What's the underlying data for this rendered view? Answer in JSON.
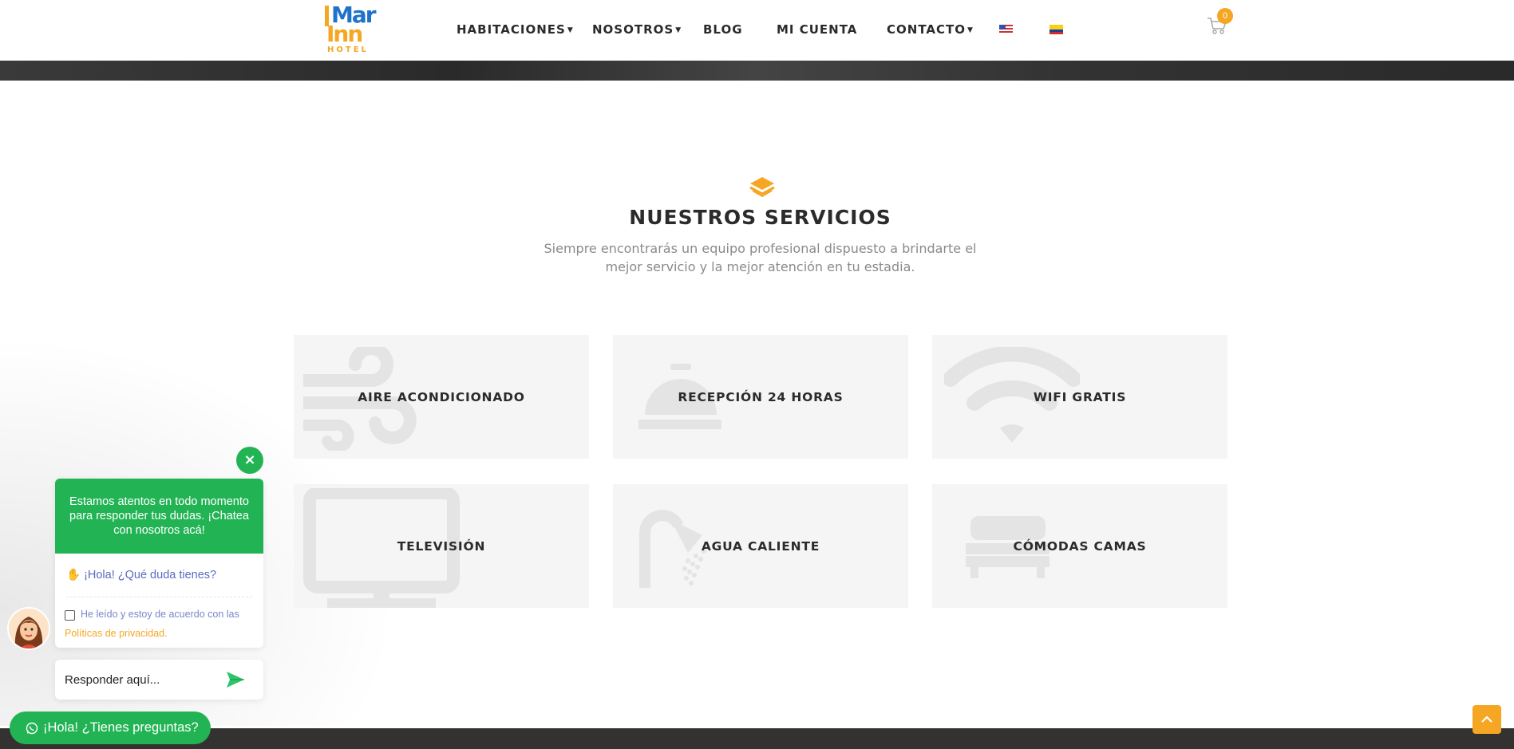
{
  "logo": {
    "line1": "Mar",
    "line2": "Inn",
    "line3": "HOTEL"
  },
  "nav": {
    "items": [
      {
        "label": "HABITACIONES",
        "has_dropdown": true
      },
      {
        "label": "NOSOTROS",
        "has_dropdown": true
      },
      {
        "label": "BLOG",
        "has_dropdown": false
      },
      {
        "label": "MI CUENTA",
        "has_dropdown": false
      },
      {
        "label": "CONTACTO",
        "has_dropdown": true
      }
    ],
    "languages": [
      "us-flag",
      "colombia-flag"
    ],
    "cart_count": "0"
  },
  "services": {
    "title": "NUESTROS SERVICIOS",
    "subtitle": "Siempre encontrarás un equipo profesional dispuesto a brindarte el mejor servicio y la mejor atención en tu estadia.",
    "items": [
      {
        "label": "AIRE ACONDICIONADO",
        "icon": "wind-icon"
      },
      {
        "label": "RECEPCIÓN 24 HORAS",
        "icon": "reception-bell-icon"
      },
      {
        "label": "WIFI GRATIS",
        "icon": "wifi-icon"
      },
      {
        "label": "TELEVISIÓN",
        "icon": "tv-icon"
      },
      {
        "label": "AGUA CALIENTE",
        "icon": "shower-icon"
      },
      {
        "label": "CÓMODAS CAMAS",
        "icon": "bed-icon"
      }
    ]
  },
  "chat": {
    "header": "Estamos atentos en todo momento para responder tus dudas. ¡Chatea con nosotros acá!",
    "greeting": "¡Hola! ¿Qué duda tienes?",
    "consent_text": "He leído y estoy de acuerdo con las",
    "policy_link": "Políticas de privacidad.",
    "reply_placeholder": "Responder aquí...",
    "launcher_label": "¡Hola! ¿Tienes preguntas?",
    "close_symbol": "×"
  },
  "colors": {
    "accent": "#f5a623",
    "chat_green": "#22b454",
    "card_bg": "#f5f5f5",
    "text_dark": "#2b2b2b"
  }
}
